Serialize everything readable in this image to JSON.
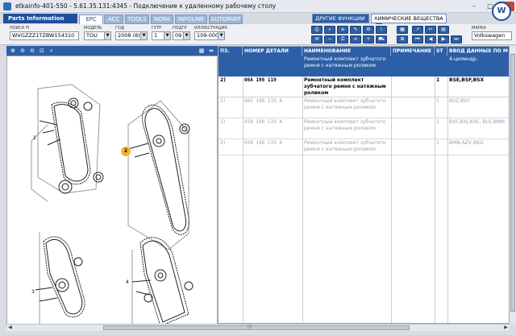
{
  "window": {
    "title": "etkainfo-401-550 - 5.61.35.131:4345 - Подключение к удаленному рабочему столу",
    "controls": [
      "–",
      "□",
      "✕"
    ]
  },
  "app": {
    "section": "Parts Information",
    "tabs": [
      "EPC",
      "ACC",
      "TOOLS",
      "NORA",
      "INFOLINE",
      "AUTOPART"
    ],
    "active_tab": "EPC",
    "logo": "W",
    "func_buttons": {
      "other_functions": "ДРУГИЕ ФУНКЦИИ",
      "other_functions_arrow": "▶",
      "chemicals": "ХИМИЧЕСКИЕ ВЕЩЕСТВА",
      "chemicals_arrow": "▼"
    }
  },
  "fields": {
    "vin": {
      "label": "ПОИСК FI",
      "value": "WVGZZZ1TZBW154310"
    },
    "model": {
      "label": "МОДЕЛЬ",
      "value": "TOU"
    },
    "year": {
      "label": "ГОД",
      "value": "2008 (8)"
    },
    "group": {
      "label": "ГУТР",
      "value": "1"
    },
    "subgroup": {
      "label": "ПОДГР",
      "value": "09"
    },
    "illustration": {
      "label": "ИЛЛЮСТРАЦИЯ",
      "value": "109-000"
    },
    "brand": {
      "label": "МАРКА",
      "value": "Volkswagen"
    }
  },
  "image_toolbar": {
    "icons": [
      "⊕",
      "⊖",
      "⊖",
      "⊡",
      "⌕"
    ],
    "right_icons": [
      "▦",
      "⇹"
    ]
  },
  "diagram": {
    "callouts": [
      "1",
      "2",
      "3",
      "4"
    ],
    "highlighted_callout": "2"
  },
  "grid": {
    "columns": [
      "ПЗ.",
      "НОМЕР ДЕТАЛИ",
      "НАИМЕНОВАНИЕ",
      "ПРИМЕЧАНИЕ",
      "ST",
      "ВВОД ДАННЫХ ПО М"
    ],
    "subheader": {
      "name": "Ремонтный комплект зубчатого ремня с натяжным роликом",
      "data": "4-цилиндр."
    },
    "rows": [
      {
        "pos": "2)",
        "part": "06A  198  119",
        "name": "Ремонтный комплект зубчатого ремня с натяжным роликом",
        "note": "",
        "qty": "1",
        "data": "BSE,BSF,BSX",
        "style": "bold"
      },
      {
        "pos": "2)",
        "part": "06F  198  119  A",
        "name": "Ремонтный комплект зубчатого ремня с натяжным роликом",
        "note": "",
        "qty": "1",
        "data": "BVZ,BVY",
        "style": "grey"
      },
      {
        "pos": "2)",
        "part": "038  198  119  A",
        "name": "Ремонтный комплект зубчатого ремня с натяжным роликом",
        "note": "",
        "qty": "1",
        "data": "BXF,BXJ,BXE, BLS,BMM",
        "style": "grey"
      },
      {
        "pos": "2)",
        "part": "038  198  119  A",
        "name": "Ремонтный комплект зубчатого ремня с натяжным роликом",
        "note": "",
        "qty": "1",
        "data": "BMN,AZV,BKD",
        "style": "grey"
      }
    ]
  },
  "scroll": {
    "left": "◀",
    "right": "▶",
    "grip": "|||"
  }
}
